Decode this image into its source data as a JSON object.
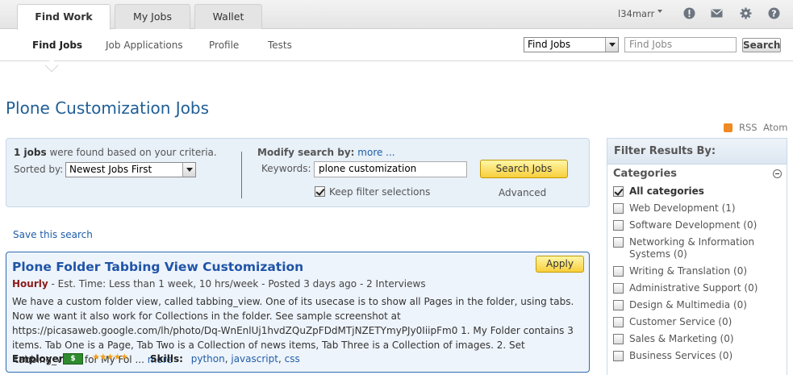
{
  "top_tabs": [
    "Find Work",
    "My Jobs",
    "Wallet"
  ],
  "user": {
    "name": "l34marr"
  },
  "subnav": {
    "items": [
      "Find Jobs",
      "Job Applications",
      "Profile",
      "Tests"
    ],
    "scope_select": "Find Jobs",
    "search_placeholder": "Find Jobs",
    "search_button": "Search"
  },
  "page_title": "Plone Customization Jobs",
  "feeds": {
    "rss": "RSS",
    "atom": "Atom"
  },
  "summary": {
    "count": "1 jobs",
    "found_text": " were found based on your criteria.",
    "sorted_label": "Sorted by:",
    "sort_value": "Newest Jobs First",
    "modify_label": "Modify search by:",
    "more_link": "more ...",
    "keywords_label": "Keywords:",
    "keywords_value": "plone customization",
    "search_button": "Search Jobs",
    "keep_filter_label": "Keep filter selections",
    "advanced_link": "Advanced"
  },
  "save_search": "Save this search",
  "job": {
    "title": "Plone Folder Tabbing View Customization",
    "apply": "Apply",
    "type": "Hourly",
    "meta": " - Est. Time: Less than 1 week, 10 hrs/week - Posted 3 days ago - 2 Interviews",
    "description": "We have a custom folder view, called tabbing_view. One of its usecase is to show all Pages in the folder, using tabs. Now we want it also work for Collections in the folder. See sample screenshot at https://picasaweb.google.com/lh/photo/Dq-WnEnlUj1hvdZQuZpFDdMTjNZETYmyPJy0IiipFm0 1. My Folder contains 3 items. Tab One is a Page, Tab Two is a Collection of news items, Tab Three is a Collection of images. 2. Set 'tabbing_view' for My Fol ...",
    "more_link": "more",
    "employer_label": "Employer:",
    "employer_badge": "$",
    "rating": "★★★★★",
    "skills_label": "Skills:",
    "skills": [
      "python",
      "javascript",
      "css"
    ]
  },
  "filter": {
    "title": "Filter Results By:",
    "categories_label": "Categories",
    "categories": [
      {
        "label": "All categories",
        "checked": true
      },
      {
        "label": "Web Development (1)",
        "checked": false
      },
      {
        "label": "Software Development (0)",
        "checked": false
      },
      {
        "label": "Networking & Information Systems (0)",
        "checked": false
      },
      {
        "label": "Writing & Translation (0)",
        "checked": false
      },
      {
        "label": "Administrative Support (0)",
        "checked": false
      },
      {
        "label": "Design & Multimedia (0)",
        "checked": false
      },
      {
        "label": "Customer Service (0)",
        "checked": false
      },
      {
        "label": "Sales & Marketing (0)",
        "checked": false
      },
      {
        "label": "Business Services (0)",
        "checked": false
      }
    ]
  },
  "colors": {
    "brand_blue": "#1f5e96",
    "link": "#1f5ea8",
    "accent_yellow": "#f8cf3c"
  },
  "icons": [
    "caret-down-icon",
    "alert-icon",
    "mail-icon",
    "gear-icon",
    "help-icon",
    "rss-icon",
    "money-icon",
    "minus-circle-icon"
  ]
}
